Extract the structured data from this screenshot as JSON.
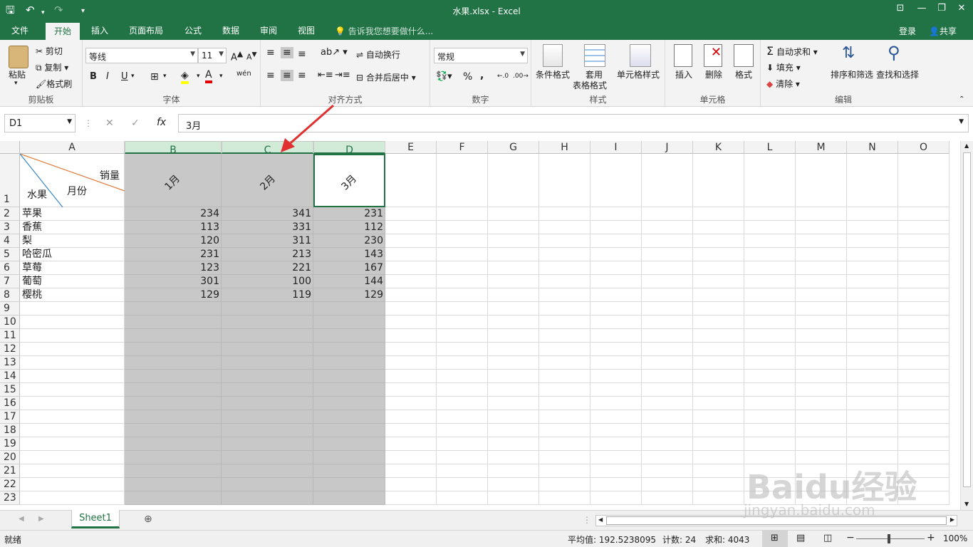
{
  "title_bar": {
    "doc_title": "水果.xlsx - Excel"
  },
  "menu_tabs": [
    "文件",
    "开始",
    "插入",
    "页面布局",
    "公式",
    "数据",
    "审阅",
    "视图"
  ],
  "tell_me": "告诉我您想要做什么...",
  "account": {
    "login": "登录",
    "share": "共享"
  },
  "ribbon": {
    "clipboard": {
      "label": "剪贴板",
      "paste": "粘贴",
      "cut": "剪切",
      "copy": "复制",
      "format_painter": "格式刷"
    },
    "font": {
      "label": "字体",
      "font_name": "等线",
      "font_size": "11",
      "bold": "B",
      "italic": "I",
      "underline": "U"
    },
    "alignment": {
      "label": "对齐方式",
      "wrap": "自动换行",
      "merge": "合并后居中"
    },
    "number": {
      "label": "数字",
      "format": "常规",
      "percent": "%",
      "comma": ","
    },
    "styles": {
      "label": "样式",
      "cond": "条件格式",
      "table1": "套用",
      "table2": "表格格式",
      "cell_styles": "单元格样式"
    },
    "cells": {
      "label": "单元格",
      "insert": "插入",
      "delete": "删除",
      "format": "格式"
    },
    "editing": {
      "label": "编辑",
      "autosum": "自动求和",
      "fill": "填充",
      "clear": "清除",
      "sort": "排序和筛选",
      "find": "查找和选择"
    }
  },
  "formula_bar": {
    "name_box": "D1",
    "formula": "3月"
  },
  "columns": [
    "A",
    "B",
    "C",
    "D",
    "E",
    "F",
    "G",
    "H",
    "I",
    "J",
    "K",
    "L",
    "M",
    "N",
    "O"
  ],
  "header_cell": {
    "sales": "销量",
    "month": "月份",
    "fruit": "水果"
  },
  "month_headers": [
    "1月",
    "2月",
    "3月"
  ],
  "rows": [
    {
      "fruit": "苹果",
      "v": [
        234,
        341,
        231
      ]
    },
    {
      "fruit": "香蕉",
      "v": [
        113,
        331,
        112
      ]
    },
    {
      "fruit": "梨",
      "v": [
        120,
        311,
        230
      ]
    },
    {
      "fruit": "哈密瓜",
      "v": [
        231,
        213,
        143
      ]
    },
    {
      "fruit": "草莓",
      "v": [
        123,
        221,
        167
      ]
    },
    {
      "fruit": "葡萄",
      "v": [
        301,
        100,
        144
      ]
    },
    {
      "fruit": "樱桃",
      "v": [
        129,
        119,
        129
      ]
    }
  ],
  "row_numbers": [
    "1",
    "2",
    "3",
    "4",
    "5",
    "6",
    "7",
    "8",
    "9",
    "10",
    "11",
    "12",
    "13",
    "14",
    "15",
    "16",
    "17",
    "18",
    "19",
    "20",
    "21",
    "22",
    "23"
  ],
  "sheet_tab": "Sheet1",
  "status": {
    "ready": "就绪",
    "average": "平均值: 192.5238095",
    "count": "计数: 24",
    "sum": "求和: 4043",
    "zoom": "100%"
  },
  "watermark": {
    "logo": "Baidu经验",
    "url": "jingyan.baidu.com"
  },
  "colors": {
    "excel_green": "#217346",
    "selection_gray": "#c8c8c8",
    "arrow_red": "#e03030"
  }
}
